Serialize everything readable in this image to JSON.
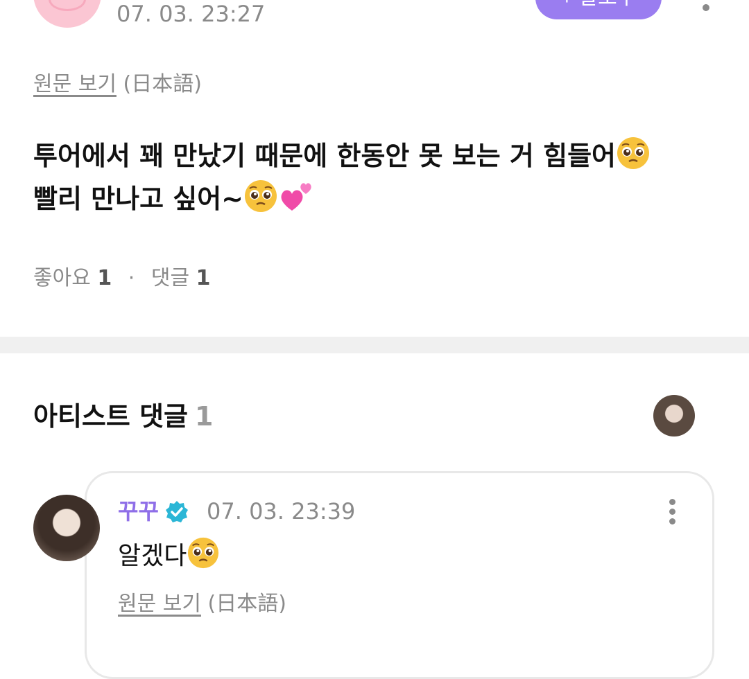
{
  "post": {
    "time": "07. 03. 23:27",
    "follow_label": "+ 팔로우",
    "original_link": "원문 보기",
    "original_lang": "(日本語)",
    "body_line1": "투어에서 꽤 만났기 때문에 한동안 못 보는 거 힘들어",
    "body_line2": "빨리 만나고 싶어~",
    "likes_label": "좋아요",
    "likes_count": "1",
    "separator": "·",
    "comments_label": "댓글",
    "comments_count": "1"
  },
  "artist_comments": {
    "title": "아티스트 댓글",
    "count": "1"
  },
  "comment": {
    "author": "꾸꾸",
    "time": "07. 03. 23:39",
    "text": "알겠다",
    "original_link": "원문 보기",
    "original_lang": "(日本語)"
  },
  "icons": {
    "emoji_pleading": "pleading-face-emoji",
    "emoji_hearts": "two-hearts-emoji",
    "verified": "verified-check-icon",
    "more": "more-vertical-icon"
  },
  "colors": {
    "accent": "#9a7df0",
    "author": "#8f6fe8",
    "verified": "#2bb6d6",
    "muted": "#8a8a8a"
  }
}
